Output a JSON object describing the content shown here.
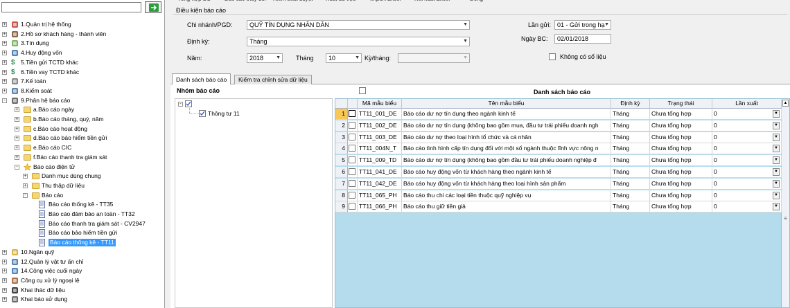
{
  "toolbar": [
    "Tổng hợp BC",
    "Báo cáo thay đổi",
    "Kiểm soát duyệt",
    "Xuất dữ liệu",
    "Import Excel",
    "Kết xuất Excel",
    "Đóng"
  ],
  "left_tree": [
    {
      "label": "1.Quản trị hệ thống",
      "level": 0,
      "exp": "+",
      "icon": "gear-icon"
    },
    {
      "label": "2.Hồ sơ khách hàng - thành viên",
      "level": 0,
      "exp": "+",
      "icon": "users-icon"
    },
    {
      "label": "3.Tín dụng",
      "level": 0,
      "exp": "+",
      "icon": "credit-icon"
    },
    {
      "label": "4.Huy động vốn",
      "level": 0,
      "exp": "+",
      "icon": "coins-icon"
    },
    {
      "label": "5.Tiền gửi TCTD khác",
      "level": 0,
      "exp": "+",
      "icon": "dollar-icon"
    },
    {
      "label": "6.Tiền vay TCTD khác",
      "level": 0,
      "exp": "+",
      "icon": "dollar-icon"
    },
    {
      "label": "7.Kế toán",
      "level": 0,
      "exp": "+",
      "icon": "ledger-icon"
    },
    {
      "label": "8.Kiểm soát",
      "level": 0,
      "exp": "+",
      "icon": "monitor-icon"
    },
    {
      "label": "9.Phân hệ báo cáo",
      "level": 0,
      "exp": "-",
      "icon": "report-icon"
    },
    {
      "label": "a.Báo cáo ngày",
      "level": 1,
      "exp": "+",
      "icon": "folder-icon"
    },
    {
      "label": "b.Báo cáo tháng, quý, năm",
      "level": 1,
      "exp": "+",
      "icon": "folder-icon"
    },
    {
      "label": "c.Báo cáo hoạt động",
      "level": 1,
      "exp": "+",
      "icon": "folder-icon"
    },
    {
      "label": "d.Báo cáo bảo hiểm tiền gửi",
      "level": 1,
      "exp": "+",
      "icon": "folder-icon"
    },
    {
      "label": "e.Báo cáo CIC",
      "level": 1,
      "exp": "+",
      "icon": "folder-icon"
    },
    {
      "label": "f.Báo cáo thanh tra giám sát",
      "level": 1,
      "exp": "+",
      "icon": "folder-icon"
    },
    {
      "label": "Báo cáo điện tử",
      "level": 1,
      "exp": "-",
      "icon": "star-icon"
    },
    {
      "label": "Danh mục dùng chung",
      "level": 2,
      "exp": "+",
      "icon": "folder-icon"
    },
    {
      "label": "Thu thập dữ liệu",
      "level": 2,
      "exp": "+",
      "icon": "folder-icon"
    },
    {
      "label": "Báo cáo",
      "level": 2,
      "exp": "-",
      "icon": "folder-icon"
    },
    {
      "label": "Báo cáo thống kê - TT35",
      "level": 3,
      "exp": "",
      "icon": "document-icon"
    },
    {
      "label": "Báo cáo đảm bảo an toàn - TT32",
      "level": 3,
      "exp": "",
      "icon": "document-icon"
    },
    {
      "label": "Báo cáo thanh tra giám sát - CV2947",
      "level": 3,
      "exp": "",
      "icon": "document-icon"
    },
    {
      "label": "Báo cáo bảo hiểm tiền gửi",
      "level": 3,
      "exp": "",
      "icon": "document-icon"
    },
    {
      "label": "Báo cáo thống kê - TT11",
      "level": 3,
      "exp": "",
      "icon": "document-icon",
      "selected": true
    },
    {
      "label": "10.Ngân quỹ",
      "level": 0,
      "exp": "+",
      "icon": "safe-icon"
    },
    {
      "label": "12.Quản lý vật tư ấn chỉ",
      "level": 0,
      "exp": "+",
      "icon": "stamp-icon"
    },
    {
      "label": "14.Công việc cuối ngày",
      "level": 0,
      "exp": "+",
      "icon": "clock-icon"
    },
    {
      "label": "Công cụ xử lý ngoại lệ",
      "level": 0,
      "exp": "+",
      "icon": "tool-icon"
    },
    {
      "label": "Khai thác dữ liệu",
      "level": 0,
      "exp": "+",
      "icon": "binoculars-icon"
    },
    {
      "label": "Khai báo sử dụng",
      "level": 0,
      "exp": "+",
      "icon": "form-icon"
    }
  ],
  "conditions": {
    "title": "Điều kiện báo cáo",
    "branch_label": "Chi nhánh/PGD:",
    "branch_value": "QUỸ TÍN DỤNG NHÂN DÂN",
    "period_label": "Định kỳ:",
    "period_value": "Tháng",
    "year_label": "Năm:",
    "year_value": "2018",
    "month_label": "Tháng",
    "month_value": "10",
    "term_label": "Kỳ/tháng:",
    "term_value": "",
    "send_label": "Lần gửi:",
    "send_value": "01 - Gửi trong hạ",
    "date_label": "Ngày BC:",
    "date_value": "02/01/2018",
    "nodata_label": "Không có số liệu"
  },
  "tabs": [
    "Danh sách báo cáo",
    "Kiểm tra chỉnh sửa dữ liệu"
  ],
  "group_panel": {
    "title": "Nhóm báo cáo",
    "child": "Thông tư 11"
  },
  "report_list": {
    "title": "Danh sách báo cáo",
    "columns": [
      "Mã mẫu biểu",
      "Tên mẫu biểu",
      "Định kỳ",
      "Trạng thái",
      "Lần xuất"
    ],
    "rows": [
      [
        "1",
        "TT11_001_DE",
        "Báo cáo dư nợ tín dụng theo ngành kinh tế",
        "Tháng",
        "Chưa tổng hợp",
        "0"
      ],
      [
        "2",
        "TT11_002_DE",
        "Báo cáo dư nợ tín dụng (không bao gồm mua, đầu tư trái phiếu doanh ngh",
        "Tháng",
        "Chưa tổng hợp",
        "0"
      ],
      [
        "3",
        "TT11_003_DE",
        "Báo cáo dư nợ theo loại hình tổ chức và cá nhân",
        "Tháng",
        "Chưa tổng hợp",
        "0"
      ],
      [
        "4",
        "TT11_004N_T",
        "Báo cáo tình hình cấp tín dụng đối với một số ngành thuộc lĩnh vực nông n",
        "Tháng",
        "Chưa tổng hợp",
        "0"
      ],
      [
        "5",
        "TT11_009_TD",
        "Báo cáo dư nợ tín dụng (không bao gồm đầu tư trái phiếu doanh nghiệp đ",
        "Tháng",
        "Chưa tổng hợp",
        "0"
      ],
      [
        "6",
        "TT11_041_DE",
        "Báo cáo huy động vốn từ khách hàng theo ngành kinh tế",
        "Tháng",
        "Chưa tổng hợp",
        "0"
      ],
      [
        "7",
        "TT11_042_DE",
        "Báo cáo huy động vốn từ khách hàng theo loại hình sản phẩm",
        "Tháng",
        "Chưa tổng hợp",
        "0"
      ],
      [
        "8",
        "TT11_065_PH",
        "Báo cáo thu chi các loại tiền thuộc quỹ nghiệp vụ",
        "Tháng",
        "Chưa tổng hợp",
        "0"
      ],
      [
        "9",
        "TT11_066_PH",
        "Báo cáo thu giữ tiền giả",
        "Tháng",
        "Chưa tổng hợp",
        "0"
      ]
    ]
  }
}
